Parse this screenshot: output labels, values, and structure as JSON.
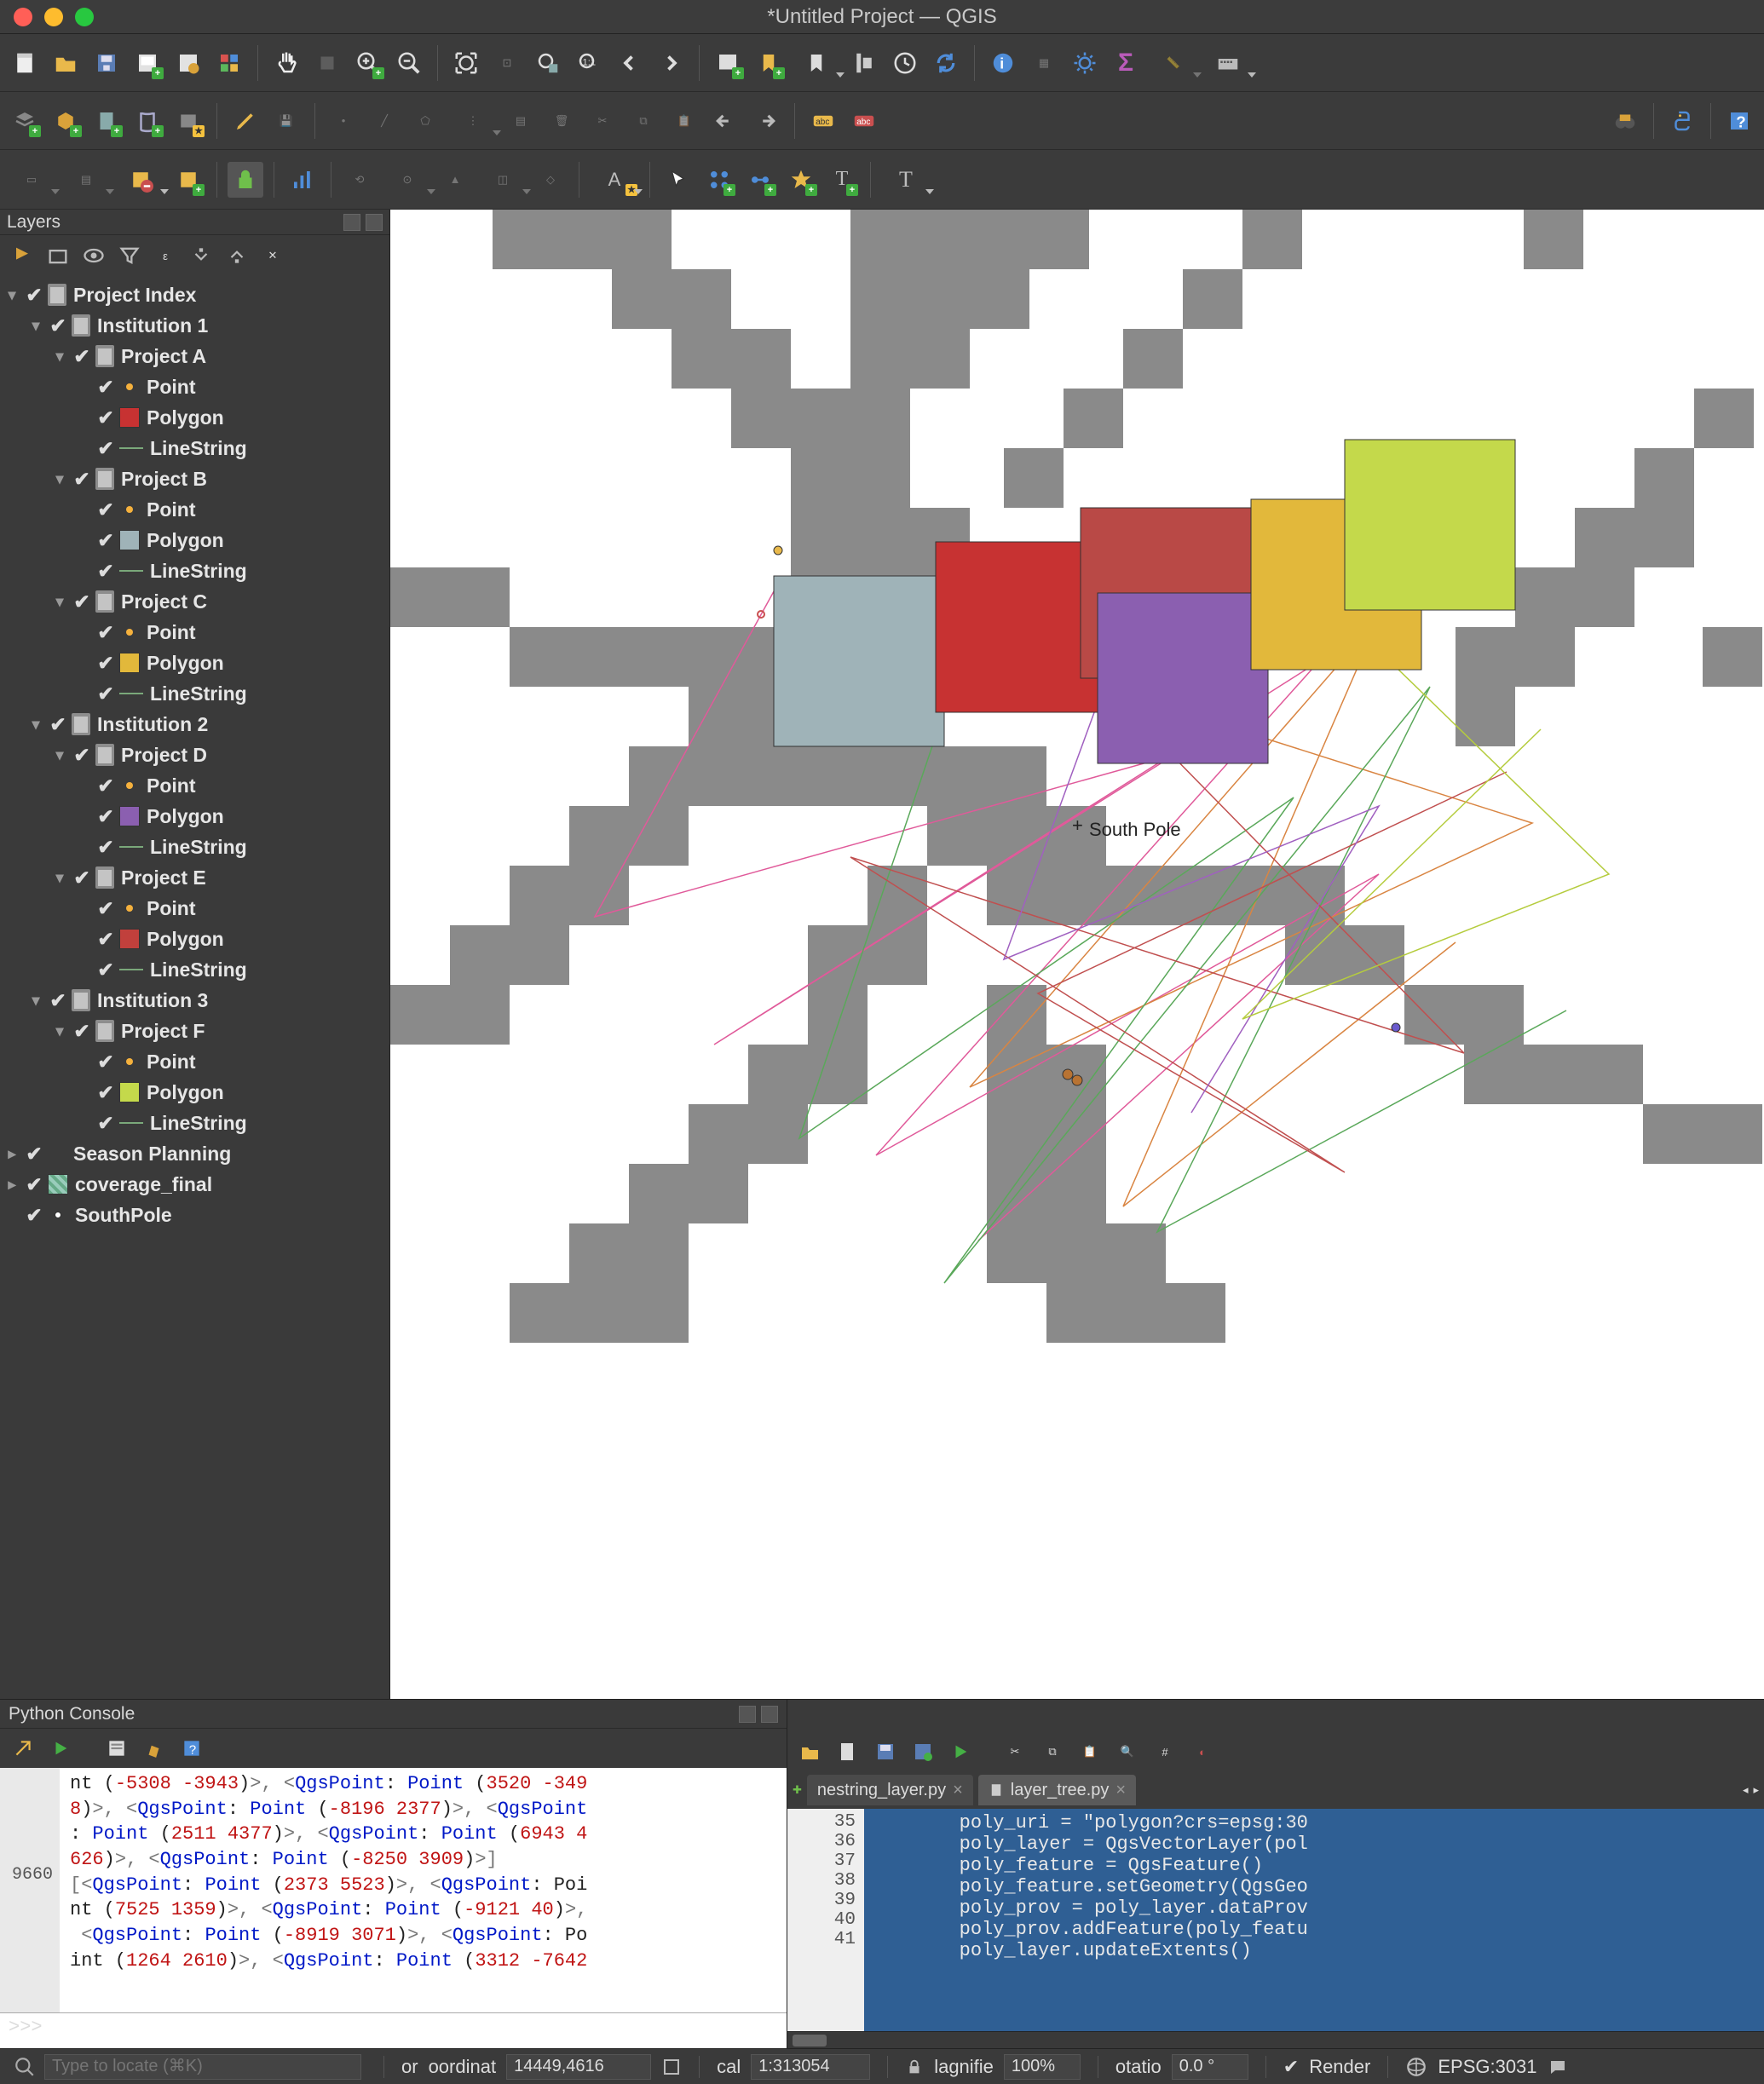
{
  "window": {
    "title": "*Untitled Project — QGIS"
  },
  "panels": {
    "layers_title": "Layers",
    "console_title": "Python Console"
  },
  "tree": {
    "root": "Project Index",
    "institutions": [
      {
        "name": "Institution 1",
        "projects": [
          {
            "name": "Project A",
            "poly_color": "#c73232"
          },
          {
            "name": "Project B",
            "poly_color": "#9fb3b8"
          },
          {
            "name": "Project C",
            "poly_color": "#e2b83b"
          }
        ]
      },
      {
        "name": "Institution 2",
        "projects": [
          {
            "name": "Project D",
            "poly_color": "#8b5fb0"
          },
          {
            "name": "Project E",
            "poly_color": "#c1403c"
          }
        ]
      },
      {
        "name": "Institution 3",
        "projects": [
          {
            "name": "Project F",
            "poly_color": "#c4d94b"
          }
        ]
      }
    ],
    "layer_types": {
      "point": "Point",
      "polygon": "Polygon",
      "linestring": "LineString"
    },
    "extra_layers": [
      "Season Planning",
      "coverage_final",
      "SouthPole"
    ]
  },
  "map": {
    "label": "South Pole"
  },
  "console": {
    "last_index": "9660",
    "lines": [
      "nt (-5308 -3943)>, <QgsPoint: Point (3520 -349",
      "8)>, <QgsPoint: Point (-8196 2377)>, <QgsPoint",
      ": Point (2511 4377)>, <QgsPoint: Point (6943 4",
      "626)>, <QgsPoint: Point (-8250 3909)>]",
      "[<QgsPoint: Point (2373 5523)>, <QgsPoint: Poi",
      "nt (7525 1359)>, <QgsPoint: Point (-9121 40)>,",
      " <QgsPoint: Point (-8919 3071)>, <QgsPoint: Po",
      "int (1264 2610)>, <QgsPoint: Point (3312 -7642"
    ],
    "prompt": ">>>"
  },
  "editor": {
    "tabs": [
      {
        "label": "nestring_layer.py",
        "active": false
      },
      {
        "label": "layer_tree.py",
        "active": true
      }
    ],
    "first_line_no": 35,
    "lines": [
      "poly_uri = \"polygon?crs=epsg:30",
      "poly_layer = QgsVectorLayer(pol",
      "poly_feature = QgsFeature()",
      "poly_feature.setGeometry(QgsGeo",
      "poly_prov = poly_layer.dataProv",
      "poly_prov.addFeature(poly_featu",
      "poly_layer.updateExtents()"
    ]
  },
  "status": {
    "locator_placeholder": "Type to locate (⌘K)",
    "coord_label": "oordinat",
    "coord_value": "14449,4616",
    "scale_label": "cal",
    "scale_value": "1:313054",
    "magnifier_label": "lagnifie",
    "magnifier_value": "100%",
    "rotation_label": "otatio",
    "rotation_value": "0.0 °",
    "render_label": "Render",
    "crs_label": "EPSG:3031",
    "coord_prefix": "or"
  }
}
